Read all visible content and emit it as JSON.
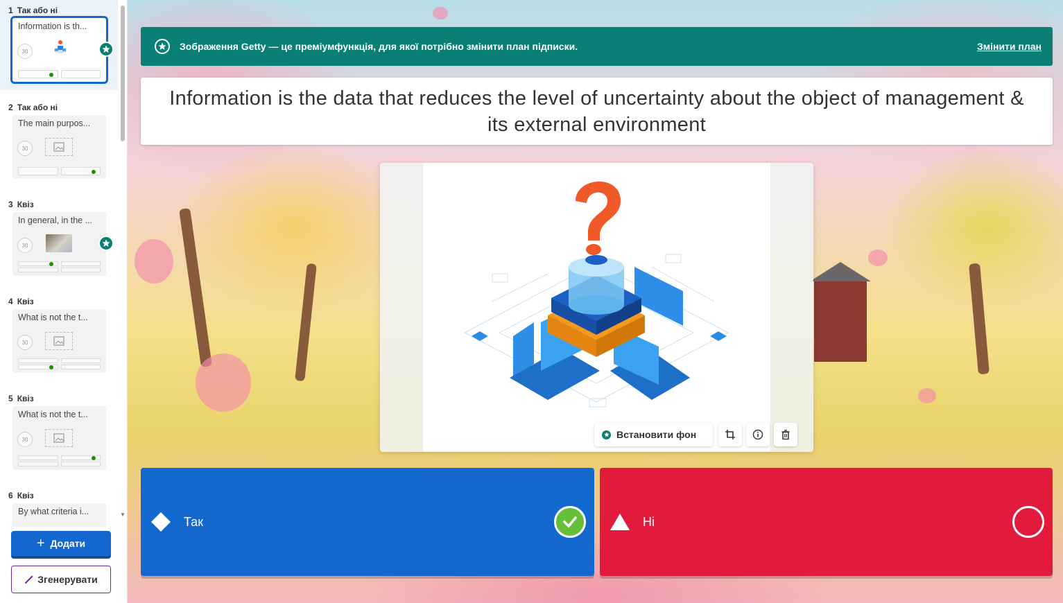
{
  "sidebar": {
    "slides": [
      {
        "number": "1",
        "type": "Так або ні",
        "title": "Information is th...",
        "timer": "30",
        "active": true,
        "premium": true
      },
      {
        "number": "2",
        "type": "Так або ні",
        "title": "The main purpos...",
        "timer": "30",
        "active": false,
        "premium": false
      },
      {
        "number": "3",
        "type": "Квіз",
        "title": "In general, in the ...",
        "timer": "30",
        "active": false,
        "premium": true
      },
      {
        "number": "4",
        "type": "Квіз",
        "title": "What is not the t...",
        "timer": "30",
        "active": false,
        "premium": false
      },
      {
        "number": "5",
        "type": "Квіз",
        "title": "What is not the t...",
        "timer": "30",
        "active": false,
        "premium": false
      },
      {
        "number": "6",
        "type": "Квіз",
        "title": "By what criteria i...",
        "timer": "30",
        "active": false,
        "premium": false
      }
    ],
    "add_button": "Додати",
    "generate_button": "Згенерувати"
  },
  "banner": {
    "text": "Зображення Getty — це преміумфункція, для якої потрібно змінити план підписки.",
    "link": "Змінити план"
  },
  "question": {
    "text": "Information is the data that reduces the level of uncertainty about the object of management & its external environment"
  },
  "media": {
    "set_background": "Встановити фон",
    "tools": [
      "crop-icon",
      "info-icon",
      "trash-icon"
    ]
  },
  "answers": [
    {
      "label": "Так",
      "shape": "diamond",
      "color": "#1368ce",
      "correct": true
    },
    {
      "label": "Ні",
      "shape": "triangle",
      "color": "#e21b3c",
      "correct": false
    }
  ],
  "colors": {
    "accent": "#1368ce",
    "premium": "#0a7f76",
    "red": "#e21b3c",
    "correct": "#66bf39"
  }
}
